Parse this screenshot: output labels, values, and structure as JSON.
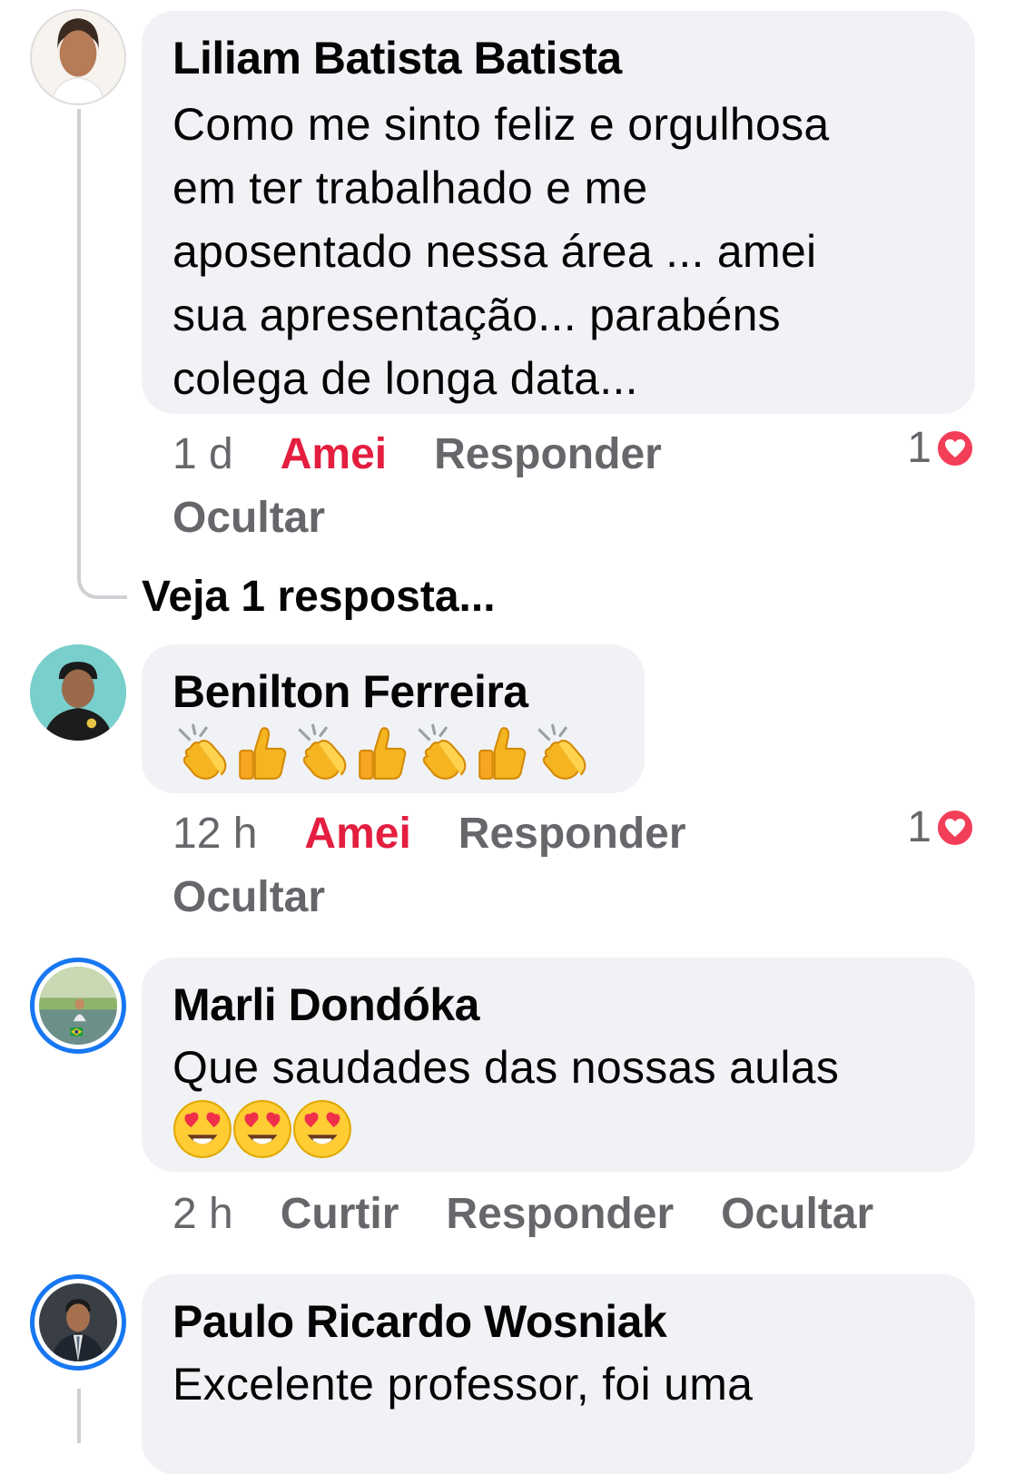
{
  "comments": [
    {
      "author": "Liliam Batista Batista",
      "text_lines": [
        "Como me sinto feliz e orgulhosa",
        "em ter trabalhado e me",
        "aposentado nessa área ... amei",
        "sua apresentação... parabéns",
        "colega de longa data..."
      ],
      "time": "1 d",
      "reaction_label": "Amei",
      "reply_label": "Responder",
      "hide_label": "Ocultar",
      "reaction_count": "1"
    },
    {
      "author": "Benilton Ferreira",
      "emoji_sequence": [
        "clapping-hands",
        "thumbs-up",
        "clapping-hands",
        "thumbs-up",
        "clapping-hands",
        "thumbs-up",
        "clapping-hands"
      ],
      "time": "12 h",
      "reaction_label": "Amei",
      "reply_label": "Responder",
      "hide_label": "Ocultar",
      "reaction_count": "1"
    },
    {
      "author": "Marli Dondóka",
      "text_lines": [
        "Que saudades das nossas aulas"
      ],
      "emoji_sequence": [
        "heart-eyes",
        "heart-eyes",
        "heart-eyes"
      ],
      "time": "2 h",
      "reaction_label": "Curtir",
      "reply_label": "Responder",
      "hide_label": "Ocultar"
    },
    {
      "author": "Paulo Ricardo Wosniak",
      "text_lines": [
        "Excelente professor, foi uma"
      ]
    }
  ],
  "see_replies": "Veja 1 resposta...",
  "colors": {
    "bubble": "#f0f2f5",
    "meta": "#65676b",
    "love": "#e41e3f",
    "story_ring": "#1877f2"
  }
}
